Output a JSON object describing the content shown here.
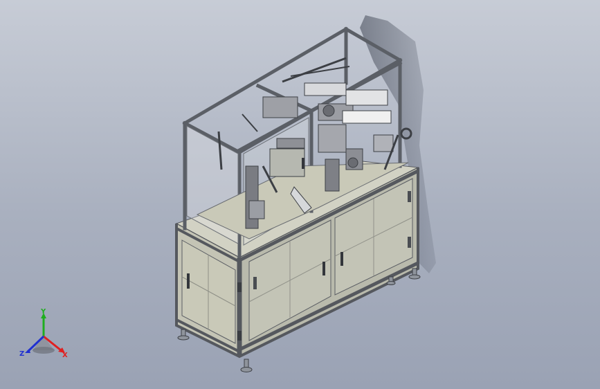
{
  "viewport": {
    "background_top": "#c7ccd6",
    "background_bottom": "#9aa2b4"
  },
  "model": {
    "frame_color": "#5b5f66",
    "panel_color": "#c9c9b8",
    "door_color": "#bfc0b2",
    "glass_color": "#e4e6e8",
    "shadow_color": "#3e4452"
  },
  "triad": {
    "y_label": "Y",
    "x_label": "X",
    "z_label": "Z",
    "y_color": "#1fae1f",
    "x_color": "#e02020",
    "z_color": "#2030d0"
  }
}
